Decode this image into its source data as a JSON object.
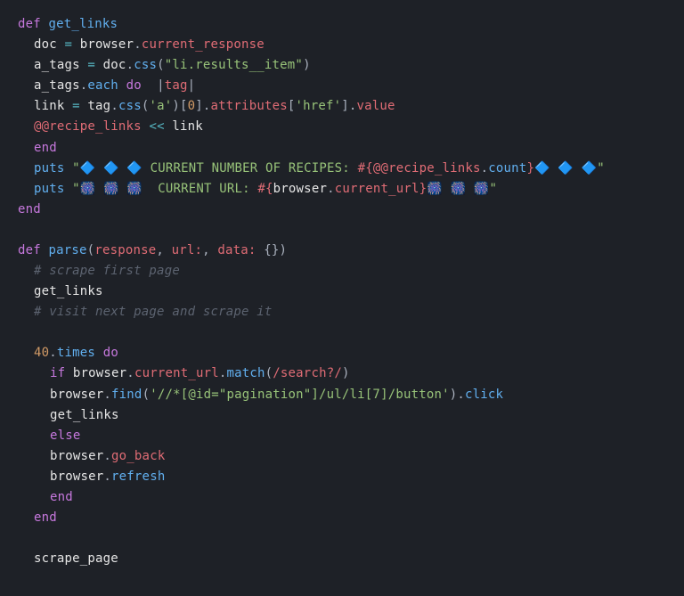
{
  "code": {
    "l1": {
      "def": "def ",
      "name": "get_links"
    },
    "l2": {
      "a": "doc ",
      "eq": "= ",
      "b": "browser",
      "d1": ".",
      "c": "current_response"
    },
    "l3": {
      "a": "a_tags ",
      "eq": "= ",
      "b": "doc",
      "d1": ".",
      "fn": "css",
      "lp": "(",
      "s": "\"li.results__item\"",
      "rp": ")"
    },
    "l4": {
      "a": "a_tags",
      "d1": ".",
      "fn": "each",
      "sp": " ",
      "do": "do ",
      "pi": " |",
      "v": "tag",
      "pe": "|"
    },
    "l5": {
      "a": "link ",
      "eq": "= ",
      "b": "tag",
      "d1": ".",
      "fn1": "css",
      "lp1": "(",
      "s1": "'a'",
      "rp1": ")[",
      "n0": "0",
      "rb": "].",
      "fn2": "attributes",
      "lb2": "[",
      "s2": "'href'",
      "rb2": "].",
      "fn3": "value"
    },
    "l6": {
      "a": "@@recipe_links",
      "op": " << ",
      "b": "link"
    },
    "l7": {
      "end": "end"
    },
    "l8": {
      "puts": "puts",
      "sp": " ",
      "q": "\"",
      "e1": "🔷 🔷 🔷 ",
      "t1": "CURRENT NUMBER OF RECIPES: ",
      "io": "#{",
      "iv": "@@recipe_links",
      "id": ".",
      "ifn": "count",
      "ic": "}",
      "e2": "🔷 🔷 🔷",
      "qe": "\""
    },
    "l9": {
      "puts": "puts",
      "sp": " ",
      "q": "\"",
      "e1": "🎆 🎆 🎆  ",
      "t1": "CURRENT URL: ",
      "io": "#{",
      "iv": "browser",
      "id": ".",
      "ifn": "current_url",
      "ic": "}",
      "e2": "🎆 🎆 🎆",
      "qe": "\""
    },
    "l10": {
      "end": "end"
    },
    "l12": {
      "def": "def ",
      "name": "parse",
      "lp": "(",
      "p1": "response",
      "c1": ", ",
      "p2": "url:",
      "c2": ", ",
      "p3": "data:",
      "sp": " ",
      "h": "{}",
      "rp": ")"
    },
    "l13": {
      "c": "# scrape first page"
    },
    "l14": {
      "a": "get_links"
    },
    "l15": {
      "c": "# visit next page and scrape it"
    },
    "l17": {
      "n": "40",
      "d": ".",
      "fn": "times",
      "sp": " ",
      "do": "do"
    },
    "l18": {
      "if": "if ",
      "a": "browser",
      "d1": ".",
      "fn1": "current_url",
      "d2": ".",
      "fn2": "match",
      "lp": "(",
      "re": "/search?/",
      "rp": ")"
    },
    "l19": {
      "a": "browser",
      "d1": ".",
      "fn1": "find",
      "lp": "(",
      "s": "'//*[@id=\"pagination\"]/ul/li[7]/button'",
      "rp": ")",
      "d2": ".",
      "fn2": "click"
    },
    "l20": {
      "a": "get_links"
    },
    "l21": {
      "else": "else"
    },
    "l22": {
      "a": "browser",
      "d": ".",
      "fn": "go_back"
    },
    "l23": {
      "a": "browser",
      "d": ".",
      "fn": "refresh"
    },
    "l24": {
      "end": "end"
    },
    "l25": {
      "end": "end"
    },
    "l27": {
      "a": "scrape_page"
    }
  }
}
